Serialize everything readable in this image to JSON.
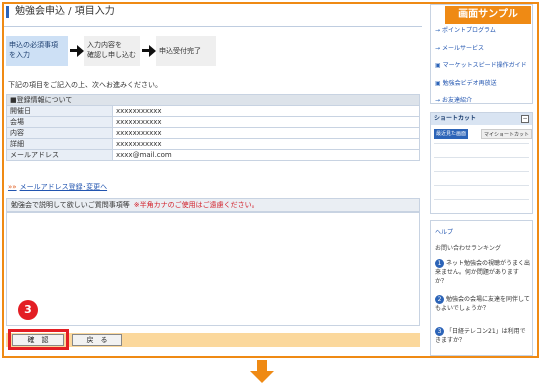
{
  "watermark": "画面サンプル",
  "page": {
    "title": "勉強会申込 / 項目入力"
  },
  "steps": [
    {
      "label_line1": "申込の必須事項",
      "label_line2": "を入力"
    },
    {
      "label_line1": "入力内容を",
      "label_line2": "確認し申し込む"
    },
    {
      "label_line1": "申込受付完了",
      "label_line2": ""
    }
  ],
  "instruction": "下記の項目をご記入の上、次へお進みください。",
  "registration": {
    "section_title": "■登録情報について",
    "rows": [
      {
        "key": "開催日",
        "value": "xxxxxxxxxxx"
      },
      {
        "key": "会場",
        "value": "xxxxxxxxxxx"
      },
      {
        "key": "内容",
        "value": "xxxxxxxxxxx"
      },
      {
        "key": "詳細",
        "value": "xxxxxxxxxxx"
      },
      {
        "key": "メールアドレス",
        "value": "xxxx@mail.com"
      }
    ]
  },
  "mail_link": {
    "marker": "»»",
    "label": "メールアドレス登録･変更へ"
  },
  "question": {
    "label": "勉強会で説明して欲しいご質問事項等",
    "warning": "※半角カナのご使用はご遠慮ください。",
    "value": ""
  },
  "badge": "3",
  "buttons": {
    "confirm": "確　認",
    "back": "戻　る"
  },
  "sidebar": {
    "menu": [
      {
        "icon": "→",
        "label": "ポイントプログラム"
      },
      {
        "icon": "→",
        "label": "メールサービス"
      },
      {
        "icon": "▣",
        "label": "マーケットスピード操作ガイド"
      },
      {
        "icon": "▣",
        "label": "勉強会ビデオ再放送"
      },
      {
        "icon": "→",
        "label": "お友達紹介"
      }
    ],
    "shortcut": {
      "title": "ショートカット",
      "minimize": "−",
      "tab_active": "最近見た画面",
      "tab_inactive": "マイショートカット"
    },
    "help": {
      "title": "ヘルプ",
      "subtitle": "お問い合わせランキング",
      "items": [
        {
          "num": "1",
          "text": "ネット勉強会の視聴がうまく出来ません。何か問題がありますか？"
        },
        {
          "num": "2",
          "text": "勉強会の会場に友達を同伴してもよいでしょうか？"
        },
        {
          "num": "3",
          "text": "「日経テレコン21」は利用できますか？"
        }
      ]
    }
  }
}
